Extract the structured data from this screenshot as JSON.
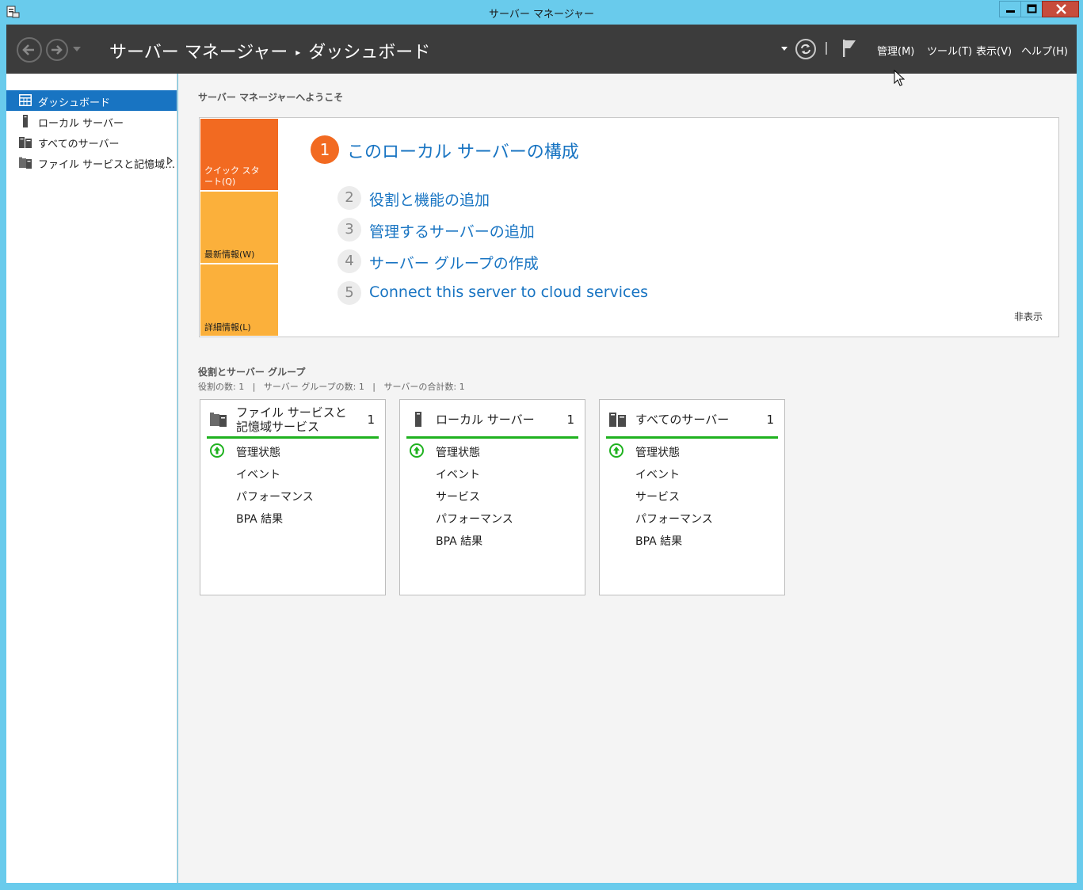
{
  "window": {
    "title": "サーバー マネージャー"
  },
  "header": {
    "breadcrumb_root": "サーバー マネージャー",
    "breadcrumb_sep": "▸",
    "breadcrumb_current": "ダッシュボード",
    "menu": {
      "manage": "管理(M)",
      "tools": "ツール(T)",
      "view": "表示(V)",
      "help": "ヘルプ(H)"
    }
  },
  "sidebar": {
    "items": [
      {
        "label": "ダッシュボード",
        "icon": "dashboard-icon",
        "selected": true
      },
      {
        "label": "ローカル サーバー",
        "icon": "server-icon"
      },
      {
        "label": "すべてのサーバー",
        "icon": "servers-icon"
      },
      {
        "label": "ファイル サービスと記憶域…",
        "icon": "file-services-icon"
      }
    ]
  },
  "welcome": {
    "title": "サーバー マネージャーへようこそ",
    "quick_tiles": {
      "quick_start": "クイック スタート(Q)",
      "whats_new": "最新情報(W)",
      "learn_more": "詳細情報(L)"
    },
    "step1": {
      "num": "1",
      "label": "このローカル サーバーの構成"
    },
    "steps": [
      {
        "num": "2",
        "label": "役割と機能の追加"
      },
      {
        "num": "3",
        "label": "管理するサーバーの追加"
      },
      {
        "num": "4",
        "label": "サーバー グループの作成"
      },
      {
        "num": "5",
        "label": "Connect this server to cloud services"
      }
    ],
    "hide": "非表示"
  },
  "roles": {
    "title": "役割とサーバー グループ",
    "summary": "役割の数: 1   |   サーバー グループの数: 1   |   サーバーの合計数: 1"
  },
  "tiles": [
    {
      "title": "ファイル サービスと記憶域サービス",
      "count": "1",
      "rows": [
        "管理状態",
        "イベント",
        "パフォーマンス",
        "BPA 結果"
      ]
    },
    {
      "title": "ローカル サーバー",
      "count": "1",
      "rows": [
        "管理状態",
        "イベント",
        "サービス",
        "パフォーマンス",
        "BPA 結果"
      ]
    },
    {
      "title": "すべてのサーバー",
      "count": "1",
      "rows": [
        "管理状態",
        "イベント",
        "サービス",
        "パフォーマンス",
        "BPA 結果"
      ]
    }
  ],
  "colors": {
    "accent_blue": "#1874c2",
    "quick_orange": "#f26a21",
    "tile_amber": "#fbb03b",
    "status_green": "#1fb21f",
    "header_dark": "#3c3c3c",
    "chrome_blue": "#69cbec"
  }
}
